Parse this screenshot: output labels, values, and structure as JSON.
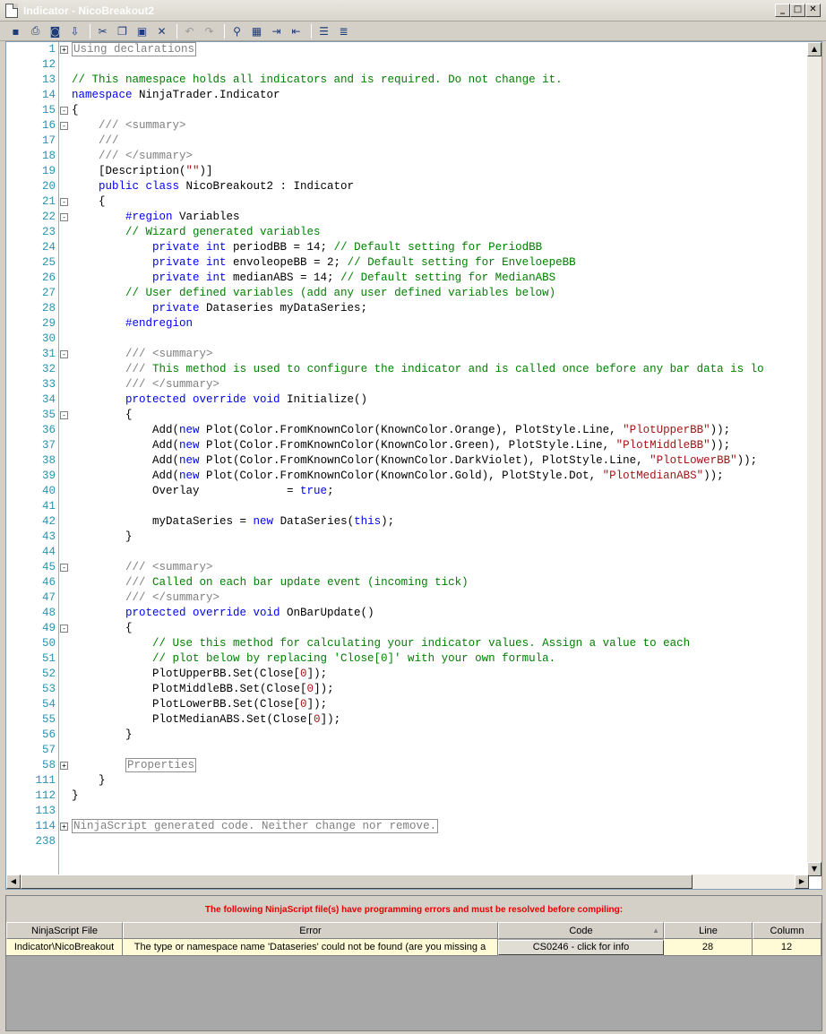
{
  "window": {
    "title": "Indicator - NicoBreakout2",
    "minimize": "_",
    "maximize": "□",
    "close": "✕"
  },
  "toolbar": {
    "icons": [
      "save-icon",
      "print-icon",
      "print-preview-icon",
      "export-icon",
      "cut-icon",
      "copy-icon",
      "paste-icon",
      "delete-icon",
      "undo-icon",
      "redo-icon",
      "find-icon",
      "replace-icon",
      "indent-icon",
      "outdent-icon",
      "comment-icon",
      "uncomment-icon"
    ]
  },
  "code_lines": [
    {
      "n": "1",
      "fold": "+",
      "html": "<span class=\"coll\">Using declarations</span>"
    },
    {
      "n": "12",
      "fold": "",
      "html": ""
    },
    {
      "n": "13",
      "fold": "",
      "html": "<span class=\"cm\">// This namespace holds all indicators and is required. Do not change it.</span>"
    },
    {
      "n": "14",
      "fold": "",
      "html": "<span class=\"kw\">namespace</span> NinjaTrader.Indicator"
    },
    {
      "n": "15",
      "fold": "-",
      "html": "{"
    },
    {
      "n": "16",
      "fold": "-",
      "html": "    <span class=\"cm-gray\">///</span> <span class=\"cm-gray\">&lt;summary&gt;</span>"
    },
    {
      "n": "17",
      "fold": "",
      "html": "    <span class=\"cm-gray\">///</span>"
    },
    {
      "n": "18",
      "fold": "",
      "html": "    <span class=\"cm-gray\">/// &lt;/summary&gt;</span>"
    },
    {
      "n": "19",
      "fold": "",
      "html": "    [Description(<span class=\"str\">\"\"</span>)]"
    },
    {
      "n": "20",
      "fold": "",
      "html": "    <span class=\"kw\">public class</span> NicoBreakout2 : Indicator"
    },
    {
      "n": "21",
      "fold": "-",
      "html": "    {"
    },
    {
      "n": "22",
      "fold": "-",
      "html": "        <span class=\"kw\">#region</span> Variables"
    },
    {
      "n": "23",
      "fold": "",
      "html": "        <span class=\"cm\">// Wizard generated variables</span>"
    },
    {
      "n": "24",
      "fold": "",
      "html": "            <span class=\"kw\">private int</span> periodBB = 14; <span class=\"cm\">// Default setting for PeriodBB</span>"
    },
    {
      "n": "25",
      "fold": "",
      "html": "            <span class=\"kw\">private int</span> envoleopeBB = 2; <span class=\"cm\">// Default setting for EnveloepeBB</span>"
    },
    {
      "n": "26",
      "fold": "",
      "html": "            <span class=\"kw\">private int</span> medianABS = 14; <span class=\"cm\">// Default setting for MedianABS</span>"
    },
    {
      "n": "27",
      "fold": "",
      "html": "        <span class=\"cm\">// User defined variables (add any user defined variables below)</span>"
    },
    {
      "n": "28",
      "fold": "",
      "html": "            <span class=\"kw\">private</span> Dataseries myDataSeries;"
    },
    {
      "n": "29",
      "fold": "",
      "html": "        <span class=\"kw\">#endregion</span>"
    },
    {
      "n": "30",
      "fold": "",
      "html": ""
    },
    {
      "n": "31",
      "fold": "-",
      "html": "        <span class=\"cm-gray\">///</span> <span class=\"cm-gray\">&lt;summary&gt;</span>"
    },
    {
      "n": "32",
      "fold": "",
      "html": "        <span class=\"cm-gray\">///</span> <span class=\"cm\">This method is used to configure the indicator and is called once before any bar data is lo</span>"
    },
    {
      "n": "33",
      "fold": "",
      "html": "        <span class=\"cm-gray\">/// &lt;/summary&gt;</span>"
    },
    {
      "n": "34",
      "fold": "",
      "html": "        <span class=\"kw\">protected override void</span> Initialize()"
    },
    {
      "n": "35",
      "fold": "-",
      "html": "        {"
    },
    {
      "n": "36",
      "fold": "",
      "html": "            Add(<span class=\"kw\">new</span> Plot(Color.FromKnownColor(KnownColor.Orange), PlotStyle.Line, <span class=\"str\">\"PlotUpperBB\"</span>));"
    },
    {
      "n": "37",
      "fold": "",
      "html": "            Add(<span class=\"kw\">new</span> Plot(Color.FromKnownColor(KnownColor.Green), PlotStyle.Line, <span class=\"str\">\"PlotMiddleBB\"</span>));"
    },
    {
      "n": "38",
      "fold": "",
      "html": "            Add(<span class=\"kw\">new</span> Plot(Color.FromKnownColor(KnownColor.DarkViolet), PlotStyle.Line, <span class=\"str\">\"PlotLowerBB\"</span>));"
    },
    {
      "n": "39",
      "fold": "",
      "html": "            Add(<span class=\"kw\">new</span> Plot(Color.FromKnownColor(KnownColor.Gold), PlotStyle.Dot, <span class=\"str\">\"PlotMedianABS\"</span>));"
    },
    {
      "n": "40",
      "fold": "",
      "html": "            Overlay             = <span class=\"kw\">true</span>;"
    },
    {
      "n": "41",
      "fold": "",
      "html": ""
    },
    {
      "n": "42",
      "fold": "",
      "html": "            myDataSeries = <span class=\"kw\">new</span> DataSeries(<span class=\"kw\">this</span>);"
    },
    {
      "n": "43",
      "fold": "",
      "html": "        }"
    },
    {
      "n": "44",
      "fold": "",
      "html": ""
    },
    {
      "n": "45",
      "fold": "-",
      "html": "        <span class=\"cm-gray\">///</span> <span class=\"cm-gray\">&lt;summary&gt;</span>"
    },
    {
      "n": "46",
      "fold": "",
      "html": "        <span class=\"cm-gray\">///</span> <span class=\"cm\">Called on each bar update event (incoming tick)</span>"
    },
    {
      "n": "47",
      "fold": "",
      "html": "        <span class=\"cm-gray\">/// &lt;/summary&gt;</span>"
    },
    {
      "n": "48",
      "fold": "",
      "html": "        <span class=\"kw\">protected override void</span> OnBarUpdate()"
    },
    {
      "n": "49",
      "fold": "-",
      "html": "        {"
    },
    {
      "n": "50",
      "fold": "",
      "html": "            <span class=\"cm\">// Use this method for calculating your indicator values. Assign a value to each</span>"
    },
    {
      "n": "51",
      "fold": "",
      "html": "            <span class=\"cm\">// plot below by replacing 'Close[0]' with your own formula.</span>"
    },
    {
      "n": "52",
      "fold": "",
      "html": "            PlotUpperBB.Set(Close[<span class=\"str\">0</span>]);"
    },
    {
      "n": "53",
      "fold": "",
      "html": "            PlotMiddleBB.Set(Close[<span class=\"str\">0</span>]);"
    },
    {
      "n": "54",
      "fold": "",
      "html": "            PlotLowerBB.Set(Close[<span class=\"str\">0</span>]);"
    },
    {
      "n": "55",
      "fold": "",
      "html": "            PlotMedianABS.Set(Close[<span class=\"str\">0</span>]);"
    },
    {
      "n": "56",
      "fold": "",
      "html": "        }"
    },
    {
      "n": "57",
      "fold": "",
      "html": ""
    },
    {
      "n": "58",
      "fold": "+",
      "html": "        <span class=\"coll\">Properties</span>"
    },
    {
      "n": "111",
      "fold": "",
      "html": "    }"
    },
    {
      "n": "112",
      "fold": "",
      "html": "}"
    },
    {
      "n": "113",
      "fold": "",
      "html": ""
    },
    {
      "n": "114",
      "fold": "+",
      "html": "<span class=\"coll\">NinjaScript generated code. Neither change nor remove.</span>"
    },
    {
      "n": "238",
      "fold": "",
      "html": ""
    }
  ],
  "errors": {
    "message": "The following NinjaScript file(s) have programming errors and must be resolved before compiling:",
    "columns": [
      "NinjaScript File",
      "Error",
      "Code",
      "Line",
      "Column"
    ],
    "rows": [
      {
        "file": "Indicator\\NicoBreakout",
        "error": "The type or namespace name 'Dataseries' could not be found (are you missing a",
        "code": "CS0246 - click for info",
        "line": "28",
        "column": "12"
      }
    ],
    "sort_indicator": "▲"
  },
  "colors": {
    "keyword": "#0000ff",
    "comment": "#008000",
    "string": "#a31515",
    "line_number": "#2b91af",
    "error_text": "#e80000",
    "error_row": "#fffbd6"
  }
}
